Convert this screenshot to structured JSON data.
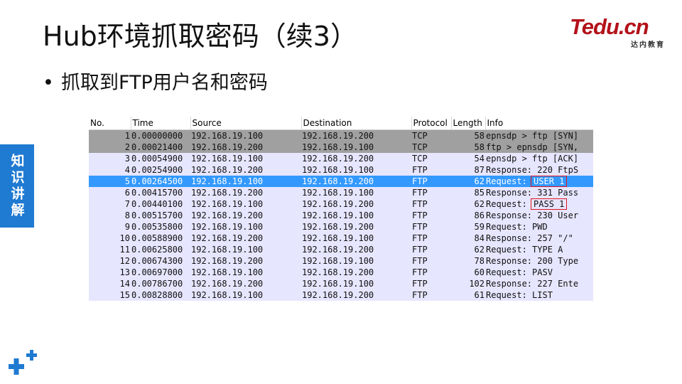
{
  "slide": {
    "title": "Hub环境抓取密码（续3）",
    "bullet": "抓取到FTP用户名和密码",
    "side_tab": "知识讲解"
  },
  "logo": {
    "text": "Tedu.cn",
    "subtitle": "达内教育"
  },
  "capture": {
    "columns": [
      "No.",
      "Time",
      "Source",
      "Destination",
      "Protocol",
      "Length",
      "Info"
    ],
    "row_colors": {
      "tcp_syn": "#a0a0a0",
      "tcp": "#e7e6ff",
      "ftp": "#e7e6ff",
      "selected": "#3399ff"
    },
    "rows": [
      {
        "no": "1",
        "time": "0.00000000",
        "source": "192.168.19.100",
        "destination": "192.168.19.200",
        "protocol": "TCP",
        "length": "58",
        "info": "epnsdp > ftp [SYN]",
        "kind": "tcp_syn"
      },
      {
        "no": "2",
        "time": "0.00021400",
        "source": "192.168.19.200",
        "destination": "192.168.19.100",
        "protocol": "TCP",
        "length": "58",
        "info": "ftp > epnsdp [SYN,",
        "kind": "tcp_syn"
      },
      {
        "no": "3",
        "time": "0.00054900",
        "source": "192.168.19.100",
        "destination": "192.168.19.200",
        "protocol": "TCP",
        "length": "54",
        "info": "epnsdp > ftp [ACK]",
        "kind": "tcp"
      },
      {
        "no": "4",
        "time": "0.00254900",
        "source": "192.168.19.200",
        "destination": "192.168.19.100",
        "protocol": "FTP",
        "length": "87",
        "info": "Response: 220 FtpS",
        "kind": "ftp"
      },
      {
        "no": "5",
        "time": "0.00264500",
        "source": "192.168.19.100",
        "destination": "192.168.19.200",
        "protocol": "FTP",
        "length": "62",
        "info": "Request: ",
        "info_highlight": "USER 1",
        "kind": "selected"
      },
      {
        "no": "6",
        "time": "0.00415700",
        "source": "192.168.19.200",
        "destination": "192.168.19.100",
        "protocol": "FTP",
        "length": "85",
        "info": "Response: 331 Pass",
        "kind": "ftp"
      },
      {
        "no": "7",
        "time": "0.00440100",
        "source": "192.168.19.100",
        "destination": "192.168.19.200",
        "protocol": "FTP",
        "length": "62",
        "info": "Request: ",
        "info_highlight": "PASS 1",
        "kind": "ftp"
      },
      {
        "no": "8",
        "time": "0.00515700",
        "source": "192.168.19.200",
        "destination": "192.168.19.100",
        "protocol": "FTP",
        "length": "86",
        "info": "Response: 230 User",
        "kind": "ftp"
      },
      {
        "no": "9",
        "time": "0.00535800",
        "source": "192.168.19.100",
        "destination": "192.168.19.200",
        "protocol": "FTP",
        "length": "59",
        "info": "Request: PWD",
        "kind": "ftp"
      },
      {
        "no": "10",
        "time": "0.00588900",
        "source": "192.168.19.200",
        "destination": "192.168.19.100",
        "protocol": "FTP",
        "length": "84",
        "info": "Response: 257 \"/\"",
        "kind": "ftp"
      },
      {
        "no": "11",
        "time": "0.00625800",
        "source": "192.168.19.100",
        "destination": "192.168.19.200",
        "protocol": "FTP",
        "length": "62",
        "info": "Request: TYPE A",
        "kind": "ftp"
      },
      {
        "no": "12",
        "time": "0.00674300",
        "source": "192.168.19.200",
        "destination": "192.168.19.100",
        "protocol": "FTP",
        "length": "78",
        "info": "Response: 200 Type",
        "kind": "ftp"
      },
      {
        "no": "13",
        "time": "0.00697000",
        "source": "192.168.19.100",
        "destination": "192.168.19.200",
        "protocol": "FTP",
        "length": "60",
        "info": "Request: PASV",
        "kind": "ftp"
      },
      {
        "no": "14",
        "time": "0.00786700",
        "source": "192.168.19.200",
        "destination": "192.168.19.100",
        "protocol": "FTP",
        "length": "102",
        "info": "Response: 227 Ente",
        "kind": "ftp"
      },
      {
        "no": "15",
        "time": "0.00828800",
        "source": "192.168.19.100",
        "destination": "192.168.19.200",
        "protocol": "FTP",
        "length": "61",
        "info": "Request: LIST",
        "kind": "ftp"
      }
    ]
  },
  "icons": {
    "corner": "plus-cluster-icon"
  }
}
